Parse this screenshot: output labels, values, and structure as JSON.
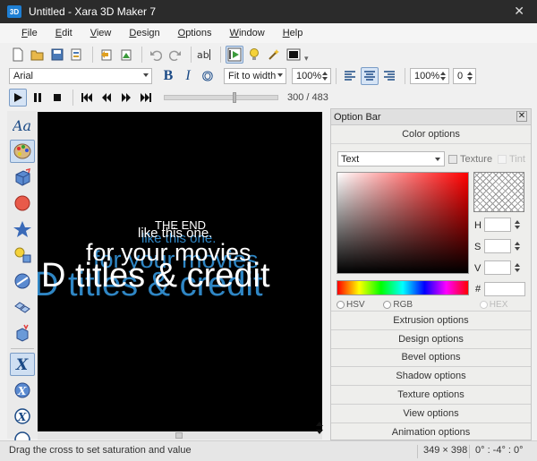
{
  "window": {
    "title": "Untitled - Xara 3D Maker 7",
    "icon_text": "3D"
  },
  "menu": [
    {
      "label": "File",
      "ul": "F",
      "rest": "ile"
    },
    {
      "label": "Edit",
      "ul": "E",
      "rest": "dit"
    },
    {
      "label": "View",
      "ul": "V",
      "rest": "iew"
    },
    {
      "label": "Design",
      "ul": "D",
      "rest": "esign"
    },
    {
      "label": "Options",
      "ul": "O",
      "rest": "ptions"
    },
    {
      "label": "Window",
      "ul": "W",
      "rest": "indow"
    },
    {
      "label": "Help",
      "ul": "H",
      "rest": "elp"
    }
  ],
  "format_bar": {
    "font": "Arial",
    "bold": "B",
    "italic": "I",
    "outline": "O",
    "fit_mode": "Fit to width",
    "zoom1": "100%",
    "zoom2": "100%",
    "offset": "0"
  },
  "playback": {
    "frame": "300 / 483"
  },
  "canvas_text": {
    "line1": "THE END",
    "line2": "like this one.",
    "line3": "for your movies",
    "line4": "D titles & credit"
  },
  "panel": {
    "title": "Option Bar",
    "color_options": "Color options",
    "select_value": "Text",
    "texture_label": "Texture",
    "tint_label": "Tint",
    "h_label": "H",
    "s_label": "S",
    "v_label": "V",
    "hex_hash": "#",
    "hsv_label": "HSV",
    "rgb_label": "RGB",
    "hex_label": "HEX",
    "options": [
      "Extrusion options",
      "Design options",
      "Bevel options",
      "Shadow options",
      "Texture options",
      "View options",
      "Animation options"
    ]
  },
  "status": {
    "hint": "Drag the cross to set saturation and value",
    "size": "349 × 398",
    "angles": "0° : -4° : 0°"
  },
  "colors": {
    "accent": "#1e7fd4",
    "text_shadow": "#2f86c4",
    "canvas_bg": "#000000"
  }
}
